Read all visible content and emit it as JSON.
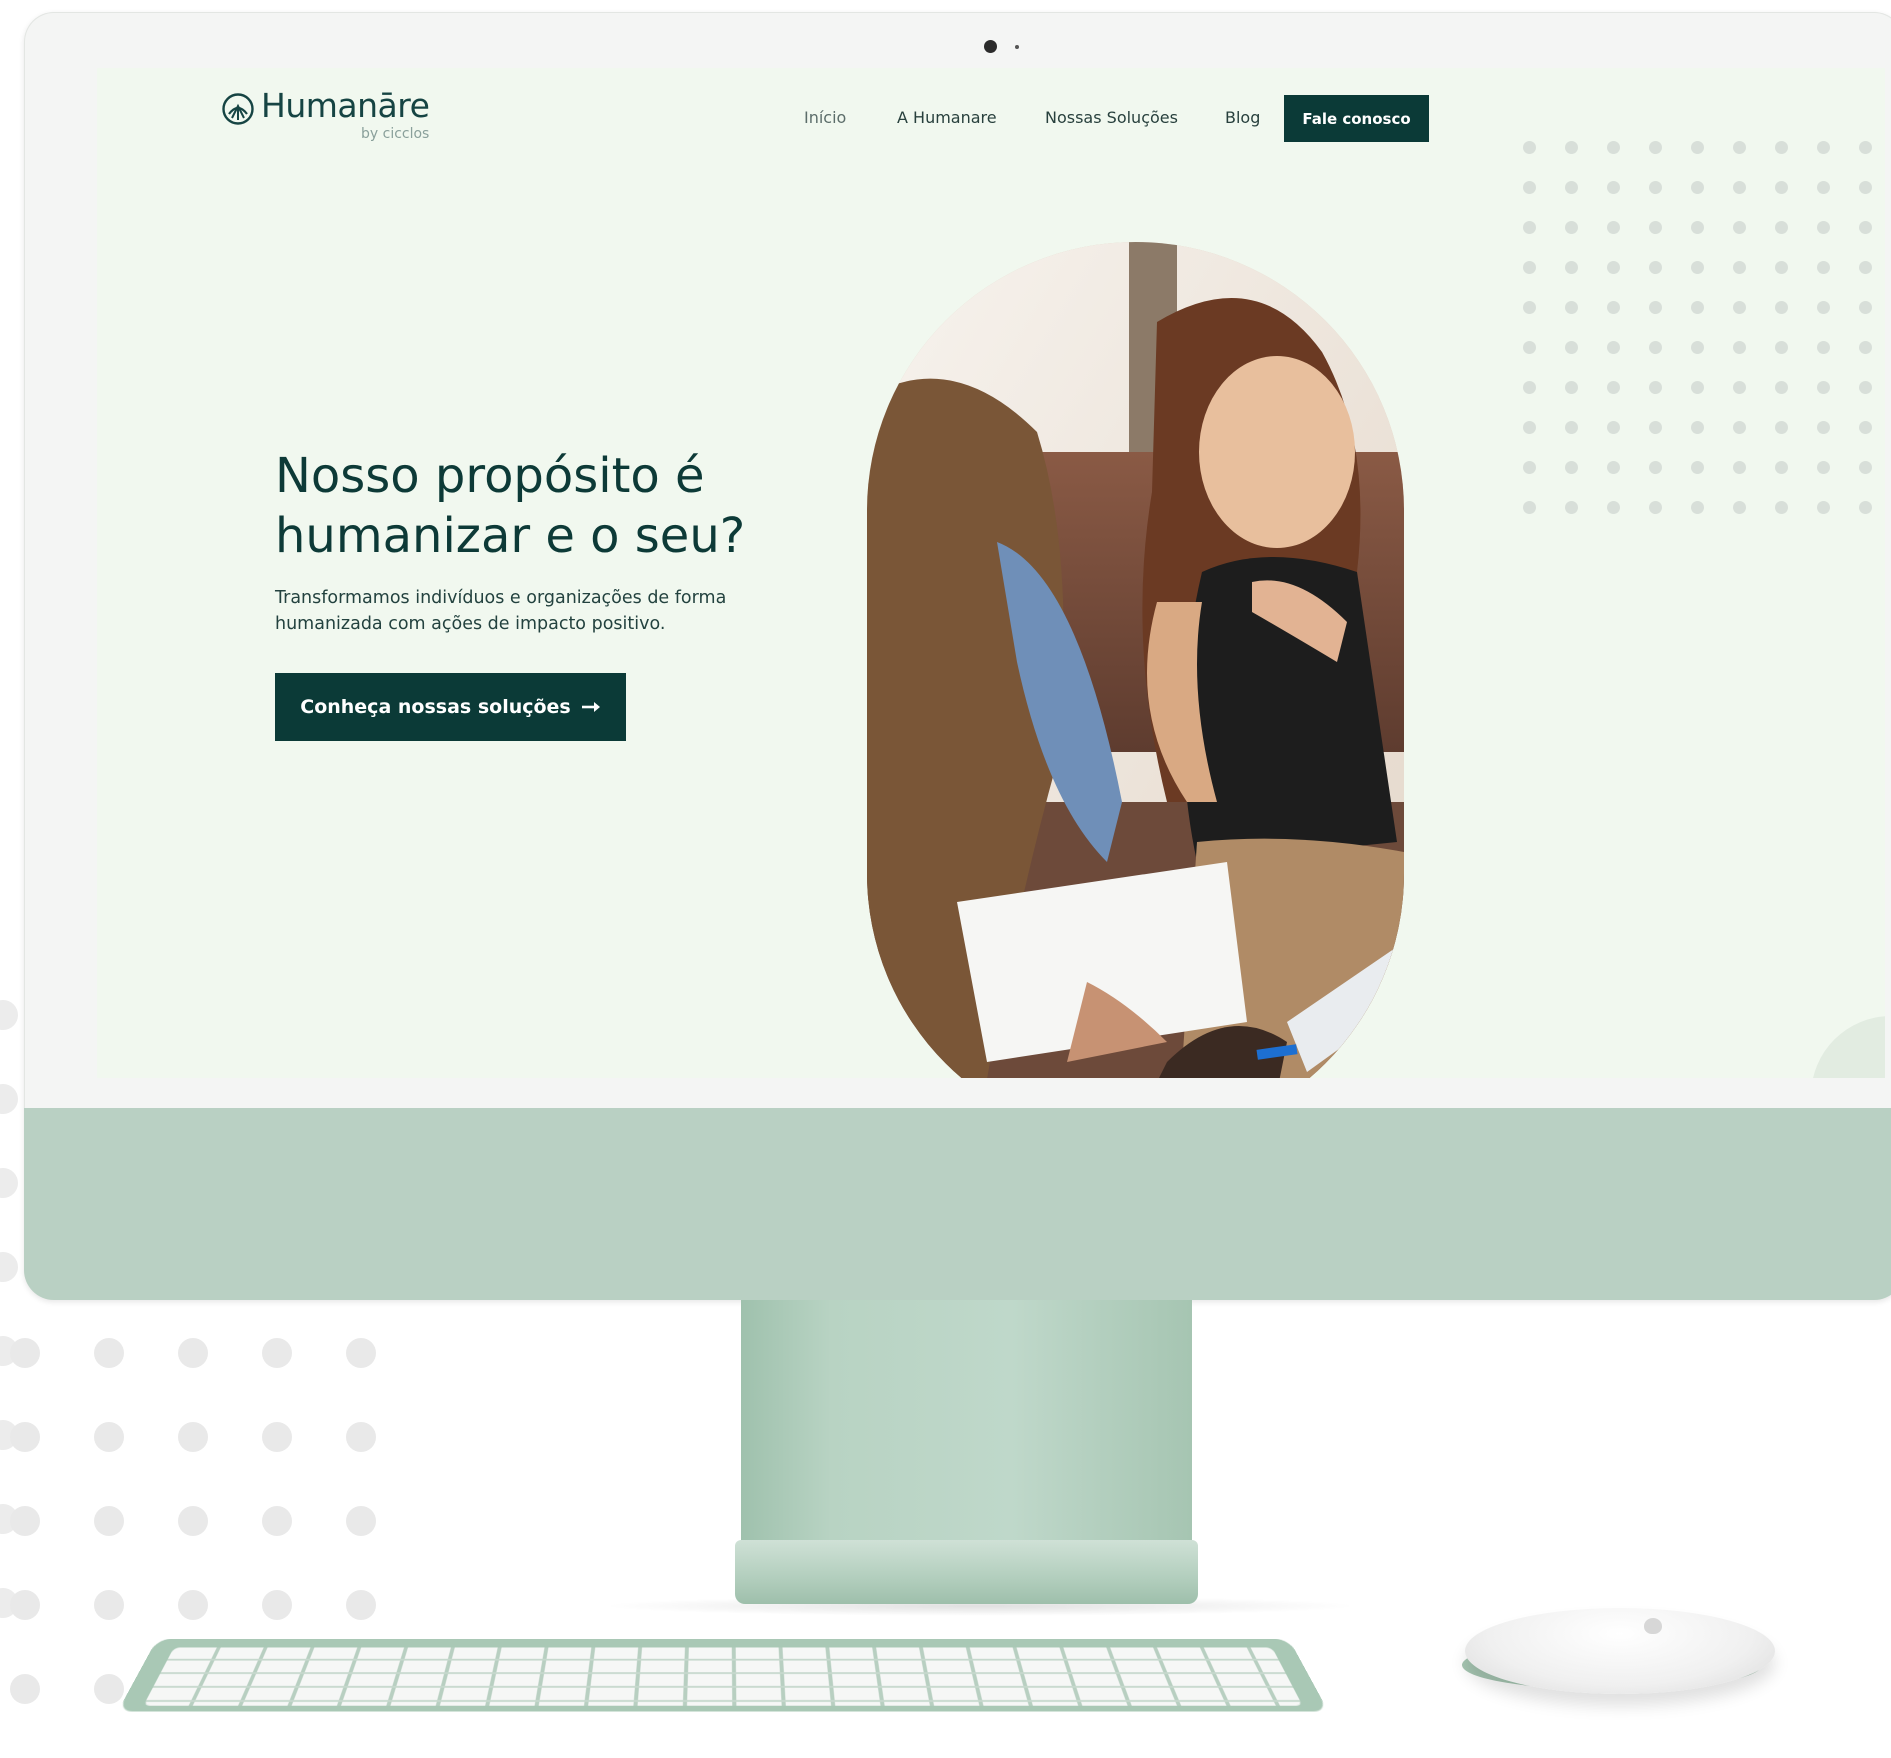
{
  "website": {
    "logo": {
      "name": "Humanāre",
      "sub": "by cicclos",
      "icon": "logo-circle-icon"
    },
    "nav": {
      "items": [
        "Início",
        "A Humanare",
        "Nossas Soluções",
        "Blog"
      ],
      "cta": "Fale conosco"
    },
    "hero": {
      "title_line1": "Nosso propósito é",
      "title_line2": "humanizar e o seu?",
      "subtitle_line1": "Transformamos indivíduos e organizações de forma",
      "subtitle_line2": "humanizada com ações de impacto positivo.",
      "button_label": "Conheça nossas soluções",
      "button_icon": "arrow-right-icon"
    }
  },
  "colors": {
    "brand_dark": "#0b3a37",
    "screen_bg": "#f1f8ef",
    "imac_green": "#b9d0c3"
  }
}
